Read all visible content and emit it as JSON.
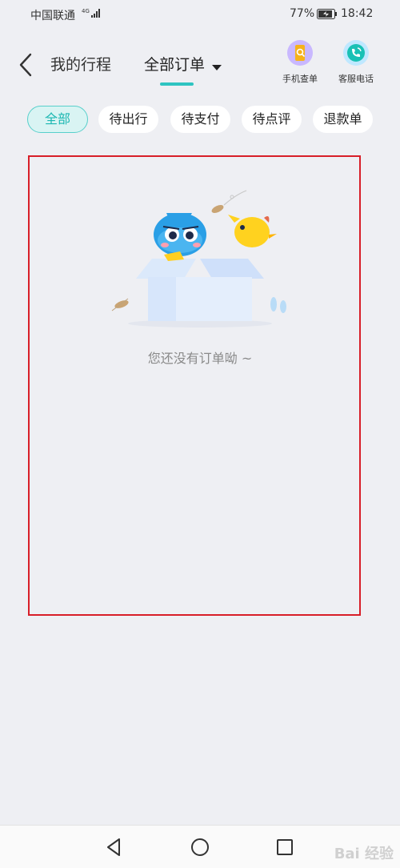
{
  "status_bar": {
    "carrier": "中国联通",
    "network": "4G",
    "battery_percent": "77%",
    "time": "18:42"
  },
  "header": {
    "back_icon": "chevron-left-icon",
    "title_trips": "我的行程",
    "title_all_orders": "全部订单",
    "phone_lookup_label": "手机查单",
    "customer_service_label": "客服电话"
  },
  "filters": [
    {
      "label": "全部",
      "active": true
    },
    {
      "label": "待出行",
      "active": false
    },
    {
      "label": "待支付",
      "active": false
    },
    {
      "label": "待点评",
      "active": false
    },
    {
      "label": "退款单",
      "active": false
    }
  ],
  "empty_state": {
    "message": "您还没有订单呦 ~"
  },
  "watermark": "Bai 经验",
  "colors": {
    "accent": "#2ec4c1",
    "highlight_box": "#d81e28",
    "background": "#eeeff3"
  }
}
